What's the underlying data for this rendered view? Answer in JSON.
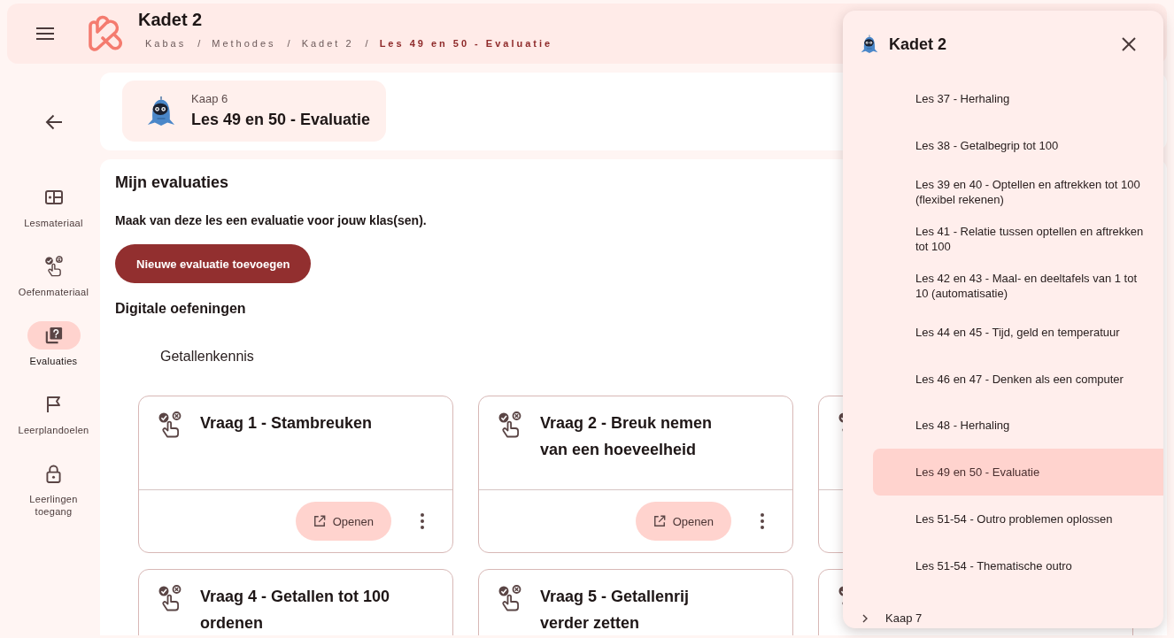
{
  "header": {
    "title": "Kadet 2",
    "breadcrumb": [
      {
        "label": "Kabas",
        "current": false
      },
      {
        "separator": "/",
        "label": "Methodes",
        "current": false
      },
      {
        "separator": "/",
        "label": "Kadet 2",
        "current": false
      },
      {
        "separator": "/",
        "label": "Les 49 en 50 - Evaluatie",
        "current": true
      }
    ]
  },
  "sidebar": {
    "items": [
      {
        "label": "Lesmateriaal",
        "selected": false
      },
      {
        "label": "Oefenmateriaal",
        "selected": false
      },
      {
        "label": "Evaluaties",
        "selected": true
      },
      {
        "label": "Leerplandoelen",
        "selected": false
      },
      {
        "label": "Leerlingen toegang",
        "selected": false
      }
    ]
  },
  "lesson": {
    "chapter": "Kaap 6",
    "title": "Les 49 en 50 - Evaluatie"
  },
  "evaluations": {
    "title": "Mijn evaluaties",
    "description": "Maak van deze les een evaluatie voor jouw klas(sen).",
    "add_button": "Nieuwe evaluatie toevoegen",
    "section": "Digitale oefeningen",
    "group": "Getallenkennis",
    "cards": [
      {
        "kind": "exercise",
        "title": "Vraag 1 - Stambreuken",
        "action": "Openen"
      },
      {
        "kind": "exercise",
        "title": "Vraag 2 - Breuk nemen van een hoeveelheid",
        "action": "Openen"
      },
      {
        "kind": "exercise"
      },
      {
        "kind": "exercise",
        "title": "Vraag 4 - Getallen tot 100 ordenen"
      },
      {
        "kind": "exercise",
        "title": "Vraag 5 - Getallenrij verder zetten"
      },
      {
        "kind": "exercise"
      }
    ]
  },
  "drawer": {
    "title": "Kadet 2",
    "lessons": [
      {
        "label": "Les 37 - Herhaling",
        "selected": false
      },
      {
        "label": "Les 38 - Getalbegrip tot 100",
        "selected": false
      },
      {
        "label": "Les 39 en 40 - Optellen en aftrekken tot 100 (flexibel rekenen)",
        "selected": false
      },
      {
        "label": "Les 41 - Relatie tussen optellen en aftrekken tot 100",
        "selected": false
      },
      {
        "label": "Les 42 en 43 - Maal- en deeltafels van 1 tot 10 (automatisatie)",
        "selected": false
      },
      {
        "label": "Les 44 en 45 - Tijd, geld en temperatuur",
        "selected": false
      },
      {
        "label": "Les 46 en 47 - Denken als een computer",
        "selected": false
      },
      {
        "label": "Les 48 - Herhaling",
        "selected": false
      },
      {
        "label": "Les 49 en 50 - Evaluatie",
        "selected": true
      },
      {
        "label": "Les 51-54 - Outro problemen oplossen",
        "selected": false
      },
      {
        "label": "Les 51-54 - Thematische outro",
        "selected": false
      }
    ],
    "chapters": [
      {
        "label": "Kaap 7",
        "expanded": false
      }
    ]
  }
}
